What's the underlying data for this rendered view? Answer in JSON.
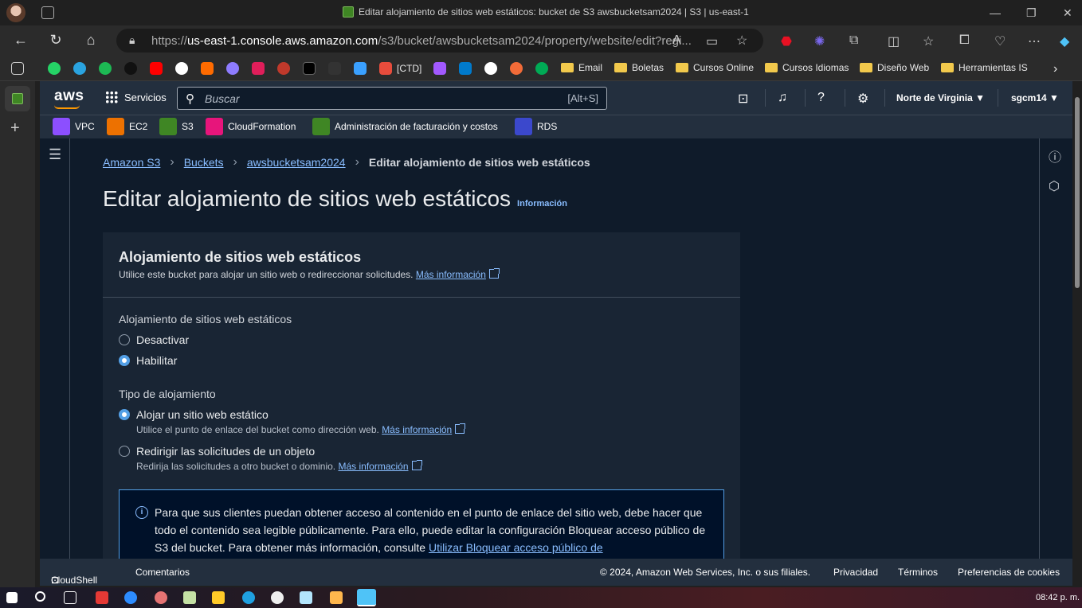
{
  "browser": {
    "window_title": "Editar alojamiento de sitios web estáticos: bucket de S3 awsbucketsam2024 | S3 | us-east-1",
    "url_prefix": "https://",
    "url_host": "us-east-1.console.aws.amazon.com",
    "url_path": "/s3/bucket/awsbucketsam2024/property/website/edit?regi...",
    "bookmarks": [
      {
        "label": "[CTD]"
      },
      {
        "label": "Email"
      },
      {
        "label": "Boletas"
      },
      {
        "label": "Cursos Online"
      },
      {
        "label": "Cursos Idiomas"
      },
      {
        "label": "Diseño Web"
      },
      {
        "label": "Herramientas IS"
      }
    ]
  },
  "aws_header": {
    "logo": "aws",
    "services_label": "Servicios",
    "search_placeholder": "Buscar",
    "search_shortcut": "[Alt+S]",
    "region": "Norte de Virginia ▼",
    "user": "sgcm14 ▼",
    "favorites": [
      {
        "label": "VPC",
        "color": "#8c4fff"
      },
      {
        "label": "EC2",
        "color": "#ed7100"
      },
      {
        "label": "S3",
        "color": "#3f8624"
      },
      {
        "label": "CloudFormation",
        "color": "#e7157b"
      },
      {
        "label": "Administración de facturación y costos",
        "color": "#3f8624"
      },
      {
        "label": "RDS",
        "color": "#3b48cc"
      }
    ]
  },
  "breadcrumb": {
    "items": [
      "Amazon S3",
      "Buckets",
      "awsbucketsam2024"
    ],
    "current": "Editar alojamiento de sitios web estáticos"
  },
  "page": {
    "title": "Editar alojamiento de sitios web estáticos",
    "info_link": "Información"
  },
  "panel": {
    "title": "Alojamiento de sitios web estáticos",
    "description": "Utilice este bucket para alojar un sitio web o redireccionar solicitudes.",
    "more_info": "Más información",
    "hosting_label": "Alojamiento de sitios web estáticos",
    "hosting_options": [
      {
        "label": "Desactivar",
        "selected": false
      },
      {
        "label": "Habilitar",
        "selected": true
      }
    ],
    "type_label": "Tipo de alojamiento",
    "type_options": [
      {
        "label": "Alojar un sitio web estático",
        "description": "Utilice el punto de enlace del bucket como dirección web.",
        "link": "Más información",
        "selected": true
      },
      {
        "label": "Redirigir las solicitudes de un objeto",
        "description": "Redirija las solicitudes a otro bucket o dominio.",
        "link": "Más información",
        "selected": false
      }
    ],
    "alert_text": "Para que sus clientes puedan obtener acceso al contenido en el punto de enlace del sitio web, debe hacer que todo el contenido sea legible públicamente. Para ello, puede editar la configuración Bloquear acceso público de S3 del bucket. Para obtener más información, consulte",
    "alert_link": "Utilizar Bloquear acceso público de"
  },
  "footer": {
    "cloudshell": "CloudShell",
    "comments": "Comentarios",
    "copyright": "© 2024, Amazon Web Services, Inc. o sus filiales.",
    "privacy": "Privacidad",
    "terms": "Términos",
    "cookies": "Preferencias de cookies"
  },
  "taskbar": {
    "time": "08:42 p. m."
  }
}
